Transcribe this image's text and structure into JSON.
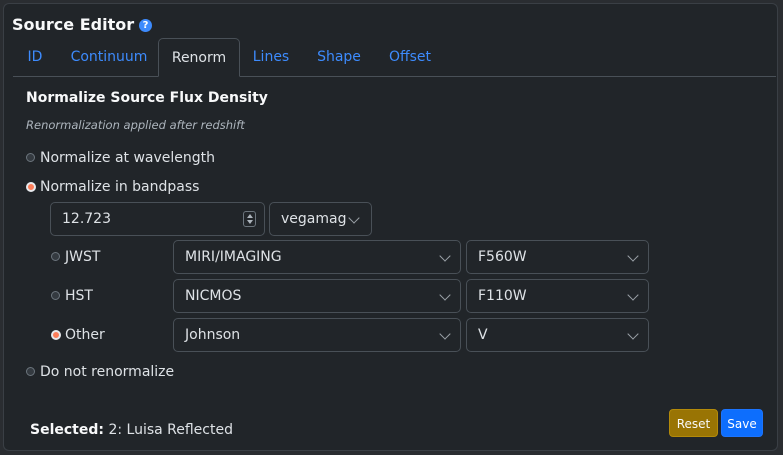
{
  "editor": {
    "title": "Source Editor",
    "help_icon": "question-circle-icon",
    "help_glyph": "?"
  },
  "tabs": [
    {
      "label": "ID",
      "active": false
    },
    {
      "label": "Continuum",
      "active": false
    },
    {
      "label": "Renorm",
      "active": true
    },
    {
      "label": "Lines",
      "active": false
    },
    {
      "label": "Shape",
      "active": false
    },
    {
      "label": "Offset",
      "active": false
    }
  ],
  "renorm": {
    "heading": "Normalize Source Flux Density",
    "subheading": "Renormalization applied after redshift",
    "mode_options": [
      {
        "label": "Normalize at wavelength",
        "checked": false
      },
      {
        "label": "Normalize in bandpass",
        "checked": true
      },
      {
        "label": "Do not renormalize",
        "checked": false
      }
    ],
    "value": "12.723",
    "unit": "vegamag",
    "bandpasses": [
      {
        "label": "JWST",
        "checked": false,
        "instrument": "MIRI/IMAGING",
        "filter": "F560W"
      },
      {
        "label": "HST",
        "checked": false,
        "instrument": "NICMOS",
        "filter": "F110W"
      },
      {
        "label": "Other",
        "checked": true,
        "instrument": "Johnson",
        "filter": "V"
      }
    ]
  },
  "footer": {
    "selected_label": "Selected:",
    "selected_value": "2: Luisa Reflected",
    "reset_label": "Reset",
    "save_label": "Save"
  },
  "colors": {
    "accent": "#3d8bfd",
    "radio_checked": "#fd7e5a",
    "reset_button": "#997404",
    "save_button": "#0d6efd"
  }
}
